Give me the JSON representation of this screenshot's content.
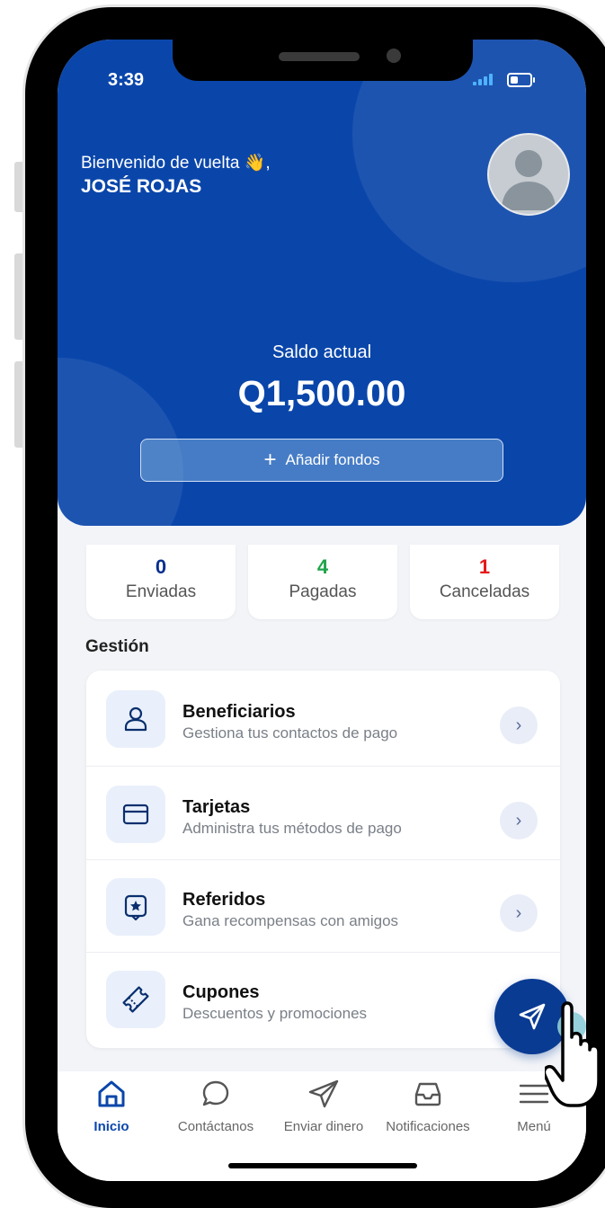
{
  "status_bar": {
    "time": "3:39"
  },
  "header": {
    "welcome": "Bienvenido de vuelta 👋,",
    "user_name": "JOSÉ ROJAS"
  },
  "balance": {
    "label": "Saldo actual",
    "amount": "Q1,500.00",
    "add_funds_label": "Añadir fondos"
  },
  "stats": [
    {
      "value": "0",
      "label": "Enviadas",
      "color": "#0a2f8f"
    },
    {
      "value": "4",
      "label": "Pagadas",
      "color": "#1ea34a"
    },
    {
      "value": "1",
      "label": "Canceladas",
      "color": "#e31b1b"
    }
  ],
  "management": {
    "section_title": "Gestión",
    "items": [
      {
        "title": "Beneficiarios",
        "subtitle": "Gestiona tus contactos de pago",
        "icon": "user-icon"
      },
      {
        "title": "Tarjetas",
        "subtitle": "Administra tus métodos de pago",
        "icon": "card-icon"
      },
      {
        "title": "Referidos",
        "subtitle": "Gana recompensas con amigos",
        "icon": "star-badge-icon"
      },
      {
        "title": "Cupones",
        "subtitle": "Descuentos y promociones",
        "icon": "ticket-icon"
      }
    ]
  },
  "nav": {
    "items": [
      {
        "label": "Inicio",
        "icon": "home-icon",
        "active": true
      },
      {
        "label": "Contáctanos",
        "icon": "chat-icon",
        "active": false
      },
      {
        "label": "Enviar dinero",
        "icon": "send-icon",
        "active": false
      },
      {
        "label": "Notificaciones",
        "icon": "inbox-icon",
        "active": false
      },
      {
        "label": "Menú",
        "icon": "menu-icon",
        "active": false
      }
    ]
  },
  "colors": {
    "primary": "#0a46aa",
    "fab": "#0a3b93",
    "icon_bg": "#e9f0fb",
    "screen_bg": "#f2f4f8"
  }
}
